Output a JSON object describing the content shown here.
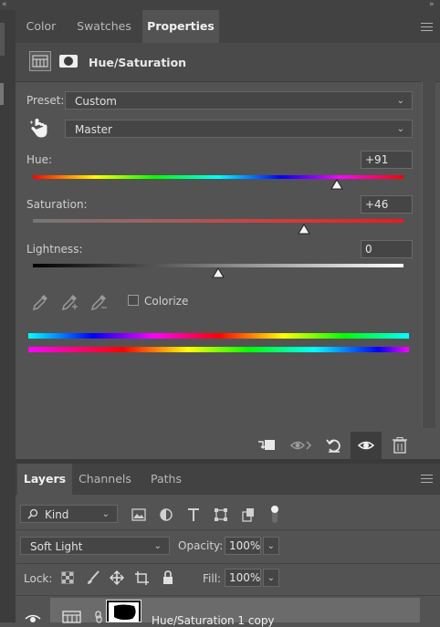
{
  "properties_tabs": [
    {
      "label": "Color",
      "active": false
    },
    {
      "label": "Swatches",
      "active": false
    },
    {
      "label": "Properties",
      "active": true
    }
  ],
  "adjustment": {
    "title": "Hue/Saturation",
    "preset_label": "Preset:",
    "preset_value": "Custom",
    "channel_value": "Master",
    "hue": {
      "label": "Hue:",
      "value": "+91",
      "position": 0.82
    },
    "saturation": {
      "label": "Saturation:",
      "value": "+46",
      "position": 0.73
    },
    "lightness": {
      "label": "Lightness:",
      "value": "0",
      "position": 0.5
    },
    "colorize_label": "Colorize",
    "colorize_checked": false
  },
  "footer_icons": [
    "clip-to-layer-icon",
    "view-previous-icon",
    "reset-icon",
    "visibility-eye-icon",
    "trash-icon"
  ],
  "layers_tabs": [
    {
      "label": "Layers",
      "active": true
    },
    {
      "label": "Channels",
      "active": false
    },
    {
      "label": "Paths",
      "active": false
    }
  ],
  "layers": {
    "filter_value": "Kind",
    "blend_mode": "Soft Light",
    "opacity_label": "Opacity:",
    "opacity_value": "100%",
    "lock_label": "Lock:",
    "fill_label": "Fill:",
    "fill_value": "100%",
    "layer_name": "Hue/Saturation 1 copy"
  }
}
